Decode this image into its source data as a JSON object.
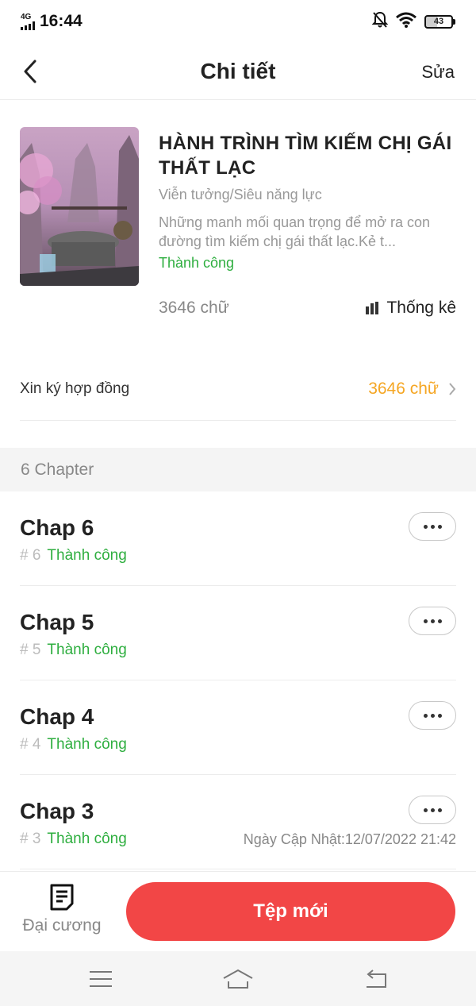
{
  "status_bar": {
    "network": "4G",
    "time": "16:44",
    "battery": "43",
    "icons": [
      "signal-icon",
      "bell-muted-icon",
      "wifi-icon",
      "battery-icon"
    ]
  },
  "header": {
    "title": "Chi tiết",
    "edit_label": "Sửa"
  },
  "book": {
    "title": "HÀNH TRÌNH TÌM KIẾM CHỊ GÁI THẤT LẠC",
    "genre": "Viễn tưởng/Siêu năng lực",
    "description": "Những manh mối quan trọng để mở ra con đường tìm kiếm chị gái thất lạc.Kẻ t...",
    "status": "Thành công",
    "word_count": "3646 chữ",
    "stats_label": "Thống kê"
  },
  "contract": {
    "label": "Xin ký hợp đồng",
    "value": "3646 chữ"
  },
  "chapter_section": {
    "count_label": "6 Chapter",
    "chapters": [
      {
        "title": "Chap 6",
        "num": "# 6",
        "status": "Thành công",
        "date": ""
      },
      {
        "title": "Chap 5",
        "num": "# 5",
        "status": "Thành công",
        "date": ""
      },
      {
        "title": "Chap 4",
        "num": "# 4",
        "status": "Thành công",
        "date": ""
      },
      {
        "title": "Chap 3",
        "num": "# 3",
        "status": "Thành công",
        "date": "Ngày Cập Nhật:12/07/2022 21:42"
      }
    ]
  },
  "action_bar": {
    "outline_label": "Đại cương",
    "new_file_label": "Tệp mới"
  },
  "colors": {
    "accent_red": "#f24646",
    "success_green": "#2eae3f",
    "word_orange": "#f5a623"
  }
}
